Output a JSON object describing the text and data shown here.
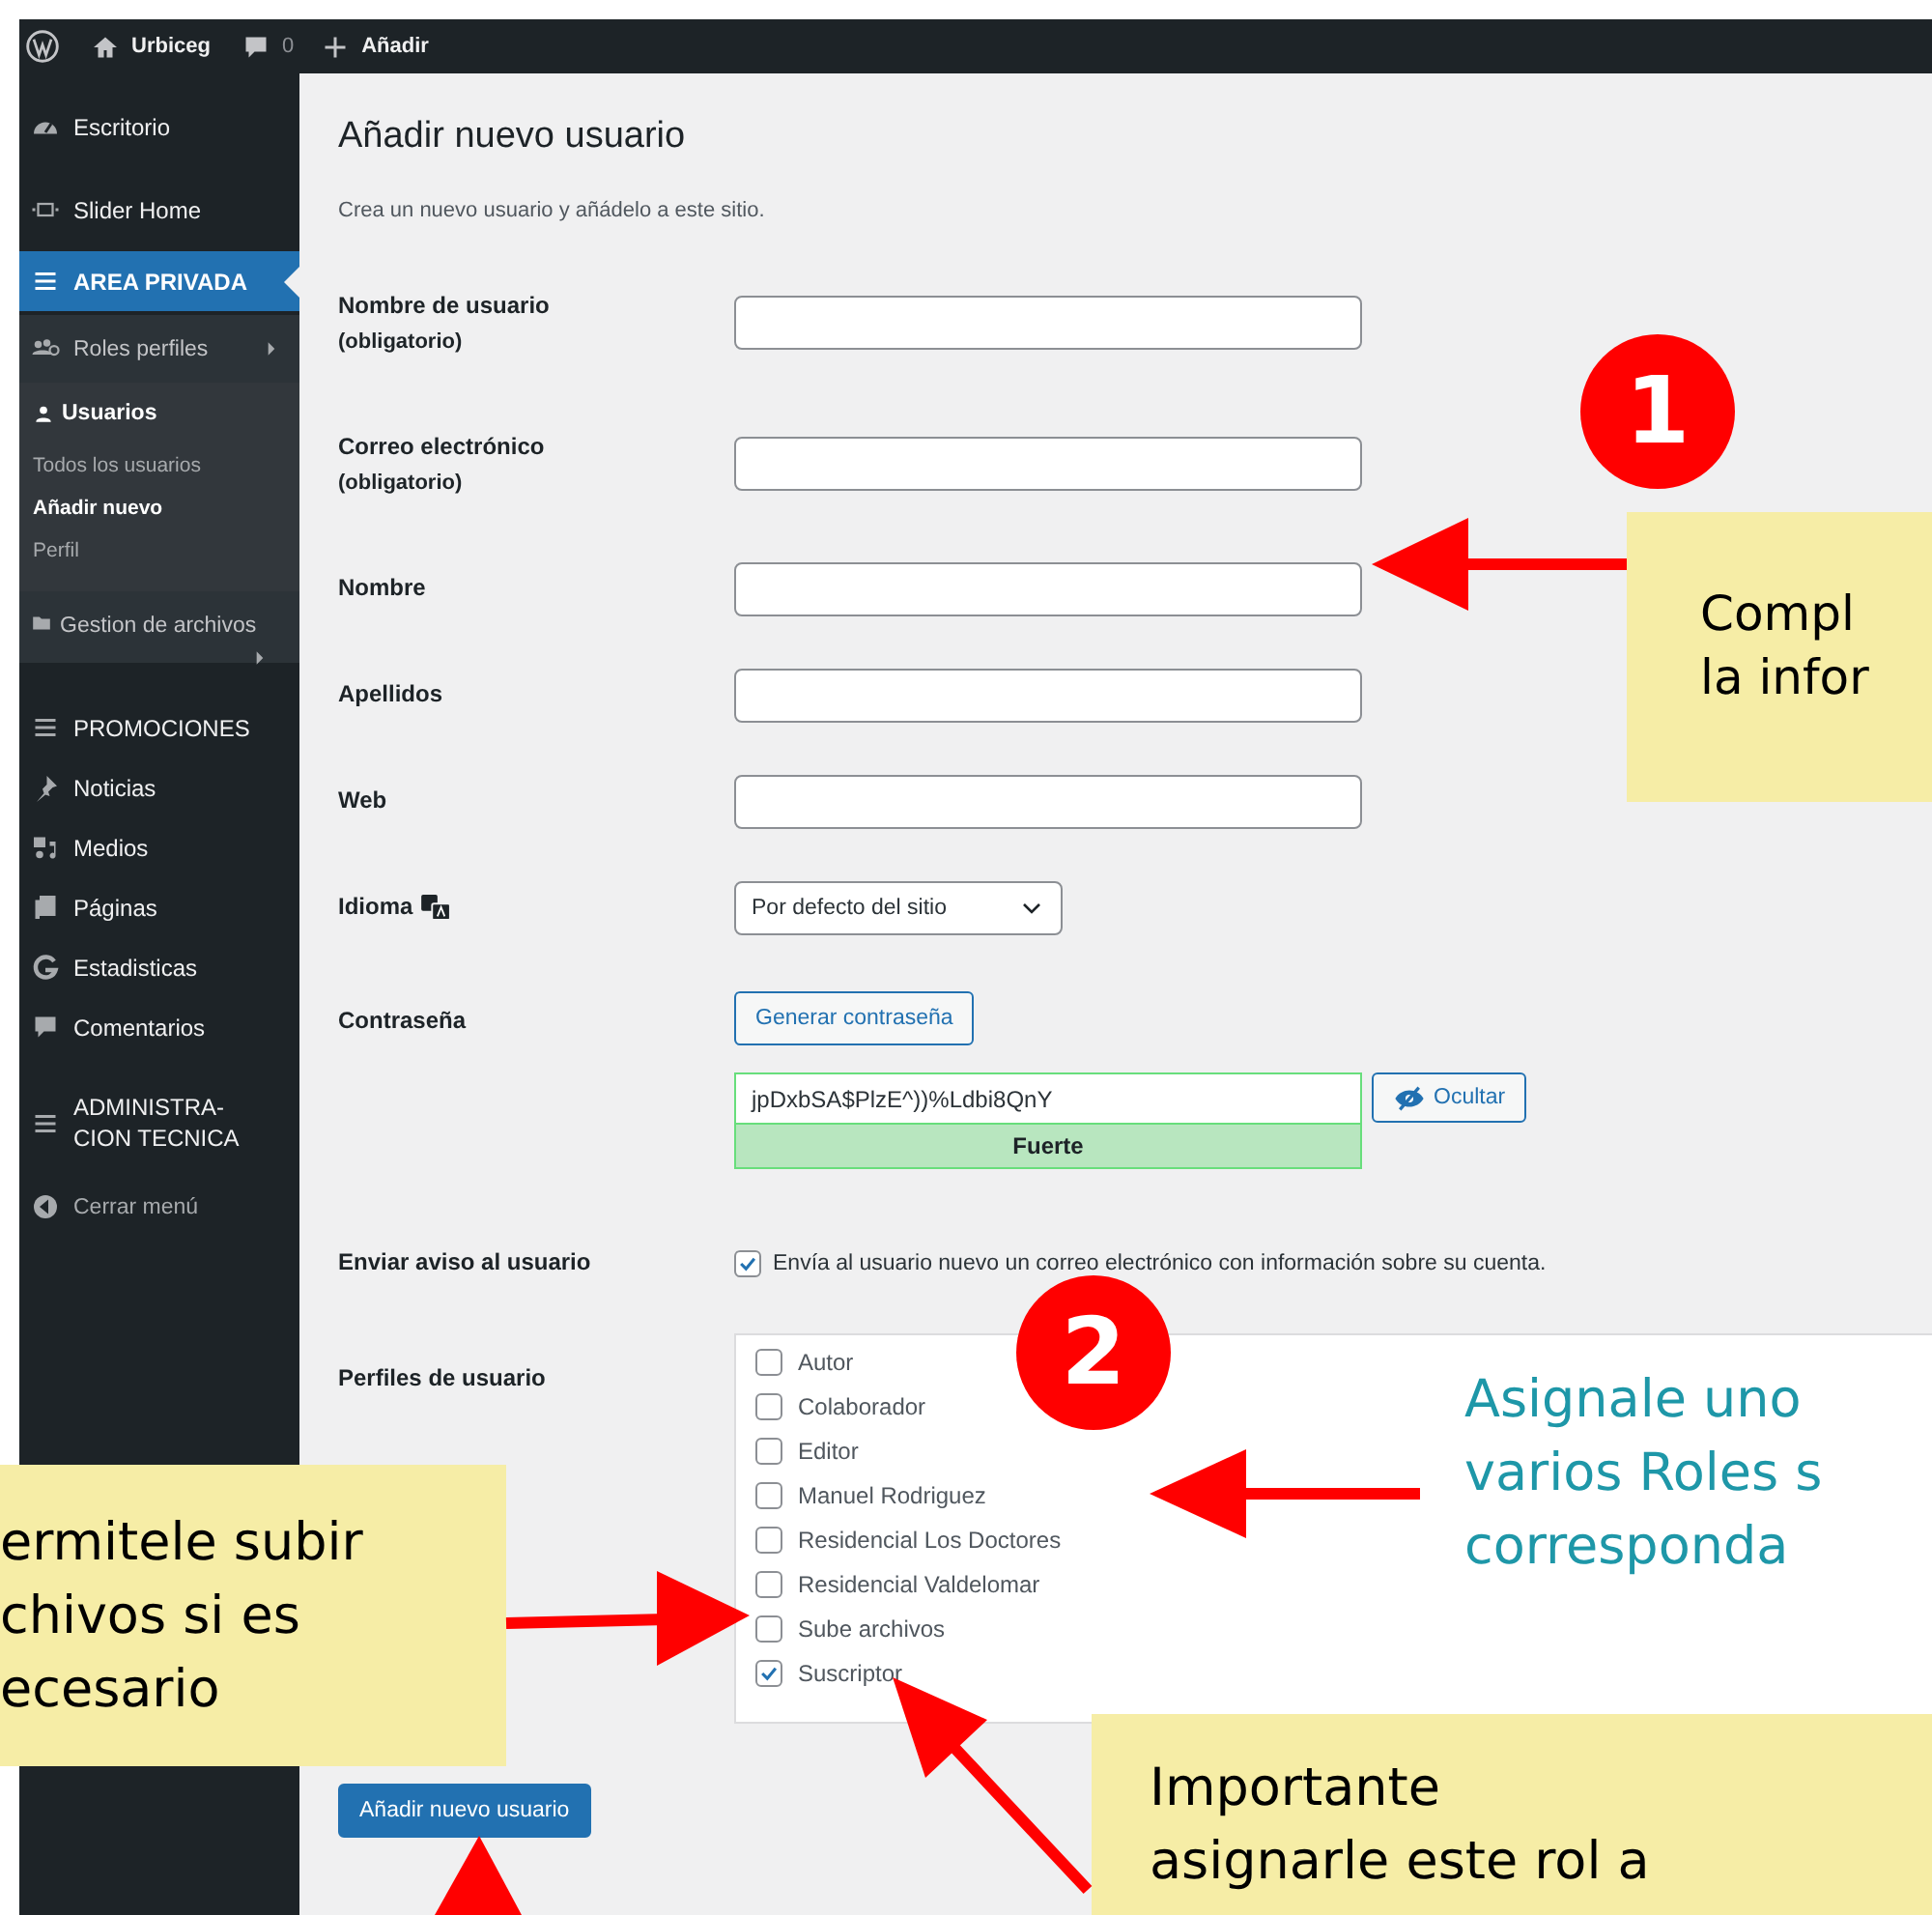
{
  "admin_bar": {
    "site": "Urbiceg",
    "comments": "0",
    "new": "Añadir"
  },
  "sidebar": {
    "items": [
      {
        "kind": "menu",
        "label": "Escritorio",
        "selected": false,
        "submenu_arrow": false
      },
      {
        "kind": "menu",
        "label": "Slider Home",
        "selected": false,
        "submenu_arrow": false
      },
      {
        "kind": "menu",
        "label": "AREA PRIVADA",
        "selected": true,
        "submenu_arrow": false
      },
      {
        "kind": "menu",
        "label": "Roles perfiles",
        "selected": false,
        "submenu_arrow": true
      },
      {
        "kind": "menu",
        "label": "Usuarios",
        "selected": false,
        "submenu_arrow": false,
        "expanded": true,
        "children": [
          {
            "label": "Todos los usuarios",
            "selected": false
          },
          {
            "label": "Añadir nuevo",
            "selected": true
          },
          {
            "label": "Perfil",
            "selected": false
          }
        ]
      },
      {
        "kind": "menu",
        "label": "Gestion de archivos",
        "selected": false,
        "submenu_arrow": true
      },
      {
        "kind": "menu",
        "label": "PROMOCIONES",
        "selected": false,
        "submenu_arrow": false
      },
      {
        "kind": "menu",
        "label": "Noticias",
        "selected": false,
        "submenu_arrow": false
      },
      {
        "kind": "menu",
        "label": "Medios",
        "selected": false,
        "submenu_arrow": false
      },
      {
        "kind": "menu",
        "label": "Páginas",
        "selected": false,
        "submenu_arrow": false
      },
      {
        "kind": "menu",
        "label": "Estadisticas",
        "selected": false,
        "submenu_arrow": false
      },
      {
        "kind": "menu",
        "label": "Comentarios",
        "selected": false,
        "submenu_arrow": false
      },
      {
        "kind": "menu",
        "label": "ADMINISTRA-CION TECNICA",
        "selected": false,
        "submenu_arrow": false
      },
      {
        "kind": "collapse",
        "label": "Cerrar menú",
        "selected": false,
        "submenu_arrow": false
      }
    ]
  },
  "form": {
    "title": "Añadir nuevo usuario",
    "description": "Crea un nuevo usuario y añádelo a este sitio.",
    "rows": [
      {
        "kind": "text",
        "label": "Nombre de usuario",
        "note": "(obligatorio)"
      },
      {
        "kind": "text",
        "label": "Correo electrónico",
        "note": "(obligatorio)"
      },
      {
        "kind": "text",
        "label": "Nombre"
      },
      {
        "kind": "text",
        "label": "Apellidos"
      },
      {
        "kind": "text",
        "label": "Web"
      },
      {
        "kind": "select",
        "label": "Idioma",
        "value": "Por defecto del sitio"
      },
      {
        "kind": "password",
        "label": "Contraseña",
        "generate": "Generar contraseña",
        "value": "jpDxbSA$PlzE^))%Ldbi8QnY",
        "toggle": "Ocultar",
        "strength": "Fuerte"
      },
      {
        "kind": "checkbox",
        "label": "Enviar aviso al usuario",
        "checked": true,
        "text": "Envía al usuario nuevo un correo electrónico con información sobre su cuenta."
      },
      {
        "kind": "roles",
        "label": "Perfiles de usuario",
        "options": [
          {
            "label": "Autor",
            "checked": false
          },
          {
            "label": "Colaborador",
            "checked": false
          },
          {
            "label": "Editor",
            "checked": false
          },
          {
            "label": "Manuel Rodriguez",
            "checked": false
          },
          {
            "label": "Residencial Los Doctores",
            "checked": false
          },
          {
            "label": "Residencial Valdelomar",
            "checked": false
          },
          {
            "label": "Sube archivos",
            "checked": false
          },
          {
            "label": "Suscriptor",
            "checked": true
          }
        ]
      }
    ],
    "submit": "Añadir nuevo usuario"
  },
  "annotations": {
    "badges": [
      "1",
      "2"
    ],
    "notes": [
      {
        "kind": "box",
        "text": "Compl\nla infor"
      },
      {
        "kind": "plain",
        "text": "Asignale uno\nvarios Roles s\ncorresponda"
      },
      {
        "kind": "box",
        "text": "ermitele subir\nchivos si es\necesario"
      },
      {
        "kind": "box",
        "text": "Importante\nasignarle este rol a"
      }
    ]
  }
}
